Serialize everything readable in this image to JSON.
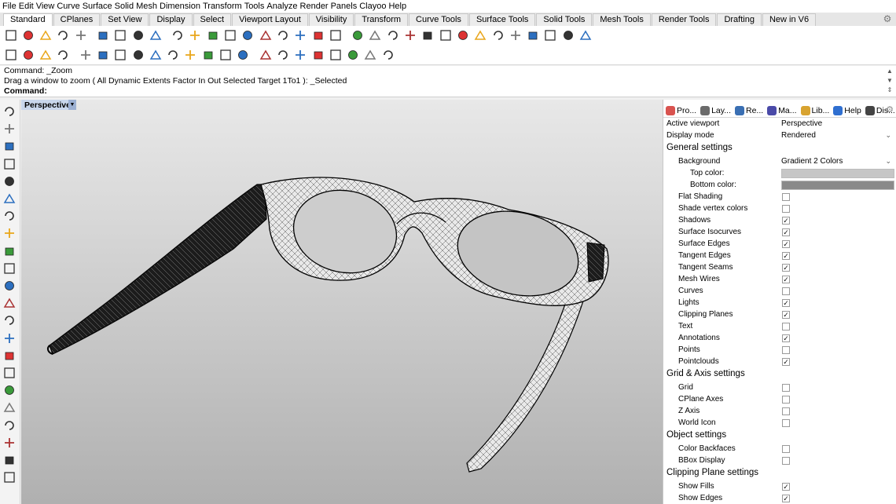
{
  "menu": [
    "File",
    "Edit",
    "View",
    "Curve",
    "Surface",
    "Solid",
    "Mesh",
    "Dimension",
    "Transform",
    "Tools",
    "Analyze",
    "Render",
    "Panels",
    "Clayoo",
    "Help"
  ],
  "tabs": [
    {
      "label": "Standard",
      "active": true
    },
    {
      "label": "CPlanes"
    },
    {
      "label": "Set View"
    },
    {
      "label": "Display"
    },
    {
      "label": "Select"
    },
    {
      "label": "Viewport Layout"
    },
    {
      "label": "Visibility"
    },
    {
      "label": "Transform"
    },
    {
      "label": "Curve Tools"
    },
    {
      "label": "Surface Tools"
    },
    {
      "label": "Solid Tools"
    },
    {
      "label": "Mesh Tools"
    },
    {
      "label": "Render Tools"
    },
    {
      "label": "Drafting"
    },
    {
      "label": "New in V6"
    }
  ],
  "toolbar1_icons": [
    "new-file-icon",
    "open-folder-icon",
    "save-icon",
    "print-icon",
    "import-icon",
    "cut-icon",
    "copy-icon",
    "paste-icon",
    "undo-icon",
    "pan-hand-icon",
    "move-icon",
    "zoom-icon",
    "zoom-window-icon",
    "zoom-extents-icon",
    "zoom-selected-icon",
    "rotate-view-icon",
    "four-viewports-icon",
    "car-icon",
    "steering-icon",
    "lasso-icon",
    "points-on-icon",
    "bulb-icon",
    "lock-icon",
    "shield-icon",
    "color-wheel-icon",
    "sphere-dark-icon",
    "sphere-shaded-icon",
    "sphere-blue-icon",
    "highlighter-icon",
    "settings-cog-icon",
    "grid-select-icon",
    "globe-icon",
    "help-icon"
  ],
  "toolbar2_icons": [
    "check-circle-icon",
    "pot-icon",
    "teapot-icon",
    "block-icon",
    "rotate-arrow-icon",
    "funnel-icon",
    "circle-target-icon",
    "triangle-ruler-icon",
    "pipe-icon",
    "star-burst-icon",
    "ring-icon",
    "sun-icon",
    "wave-icon",
    "hat-icon",
    "cube-icon",
    "box-open-icon",
    "box-closed-icon",
    "grass-icon",
    "tag-icon",
    "globe-grid-icon",
    "pencil-rod-icon",
    "crosshair-icon"
  ],
  "command": {
    "line1": "Command: _Zoom",
    "line2": "Drag a window to zoom ( All  Dynamic  Extents  Factor  In  Out  Selected  Target  1To1 ): _Selected",
    "prompt": "Command:",
    "input_value": ""
  },
  "left_tools": [
    "select-arrow-icon",
    "point-icon",
    "polyline-icon",
    "rectangle-icon",
    "circle-icon",
    "arc-icon",
    "polygon-icon",
    "ellipse-icon",
    "curve-icon",
    "surface-icon",
    "extrude-icon",
    "box-solid-icon",
    "boolean-icon",
    "cylinder-icon",
    "mesh-icon",
    "explode-icon",
    "transform-icon",
    "align-icon",
    "layers-icon",
    "group-icon",
    "array-icon",
    "hook-icon"
  ],
  "viewport": {
    "label": "Perspective"
  },
  "panel_tabs": [
    {
      "label": "Pro...",
      "color": "#d9534f"
    },
    {
      "label": "Lay...",
      "color": "#6b6b6b"
    },
    {
      "label": "Re...",
      "color": "#3a6fb3"
    },
    {
      "label": "Ma...",
      "color": "#4a4aa8"
    },
    {
      "label": "Lib...",
      "color": "#d8a330"
    },
    {
      "label": "Help",
      "color": "#2f6fd0"
    },
    {
      "label": "Dis...",
      "color": "#444444"
    }
  ],
  "properties": {
    "active_viewport_label": "Active viewport",
    "active_viewport_value": "Perspective",
    "display_mode_label": "Display mode",
    "display_mode_value": "Rendered",
    "general_settings": "General settings",
    "background_label": "Background",
    "background_value": "Gradient 2 Colors",
    "top_color_label": "Top color:",
    "top_color": "#c6c6c6",
    "bottom_color_label": "Bottom color:",
    "bottom_color": "#8a8a8a",
    "general_checks": [
      {
        "label": "Flat Shading",
        "checked": false
      },
      {
        "label": "Shade vertex colors",
        "checked": false
      },
      {
        "label": "Shadows",
        "checked": true
      },
      {
        "label": "Surface Isocurves",
        "checked": true
      },
      {
        "label": "Surface Edges",
        "checked": true
      },
      {
        "label": "Tangent Edges",
        "checked": true
      },
      {
        "label": "Tangent Seams",
        "checked": true
      },
      {
        "label": "Mesh Wires",
        "checked": true
      },
      {
        "label": "Curves",
        "checked": false
      },
      {
        "label": "Lights",
        "checked": true
      },
      {
        "label": "Clipping Planes",
        "checked": true
      },
      {
        "label": "Text",
        "checked": false
      },
      {
        "label": "Annotations",
        "checked": true
      },
      {
        "label": "Points",
        "checked": false
      },
      {
        "label": "Pointclouds",
        "checked": true
      }
    ],
    "grid_settings": "Grid & Axis settings",
    "grid_checks": [
      {
        "label": "Grid",
        "checked": false
      },
      {
        "label": "CPlane Axes",
        "checked": false
      },
      {
        "label": "Z Axis",
        "checked": false
      },
      {
        "label": "World Icon",
        "checked": false
      }
    ],
    "object_settings": "Object settings",
    "object_checks": [
      {
        "label": "Color Backfaces",
        "checked": false
      },
      {
        "label": "BBox Display",
        "checked": false
      }
    ],
    "clipping_settings": "Clipping Plane settings",
    "clipping_checks": [
      {
        "label": "Show Fills",
        "checked": true
      },
      {
        "label": "Show Edges",
        "checked": true
      }
    ]
  }
}
